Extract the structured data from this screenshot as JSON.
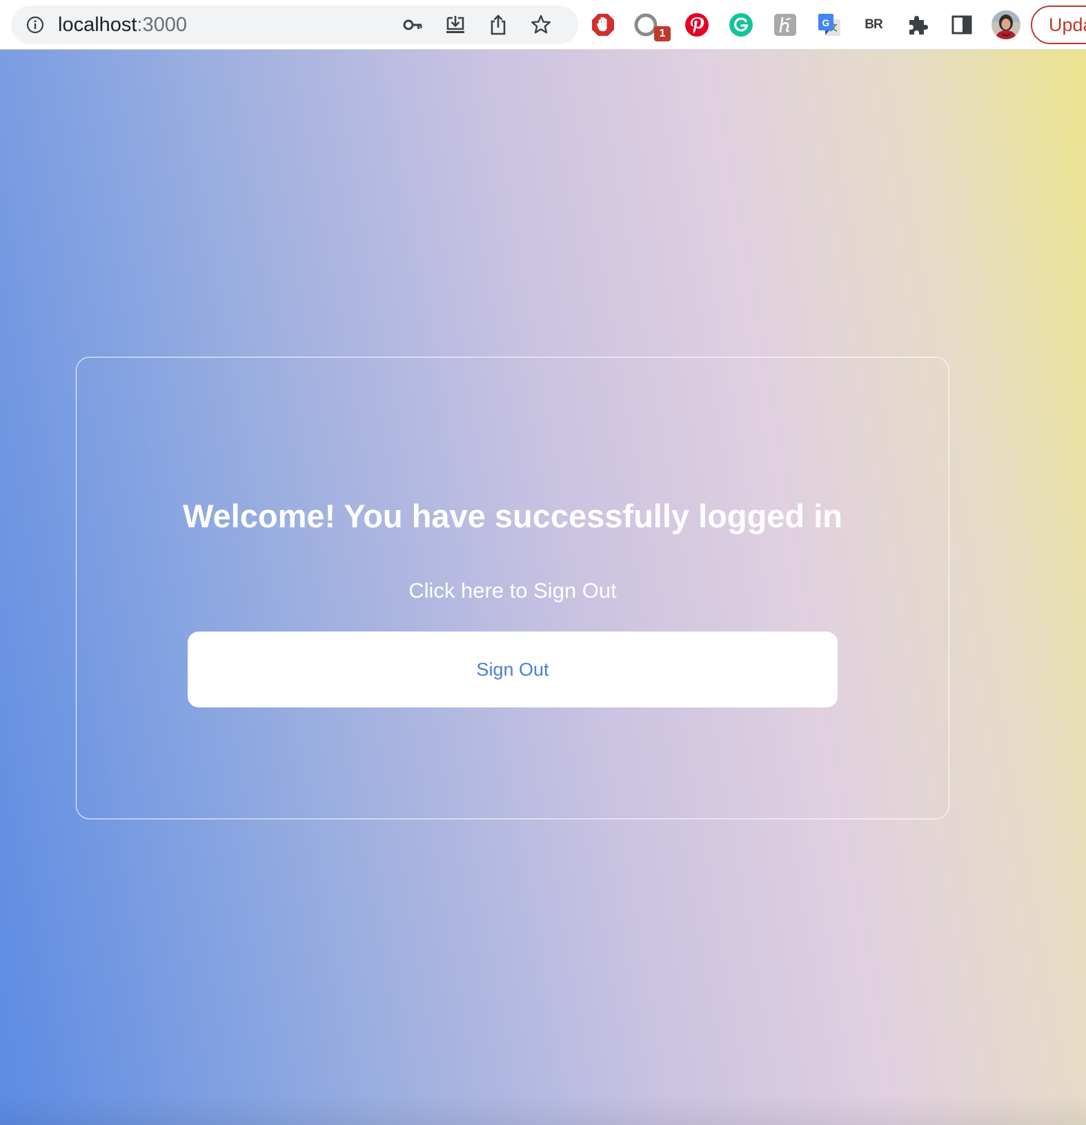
{
  "browser": {
    "url_host": "localhost",
    "url_port": ":3000",
    "extension_badge_count": "1",
    "br_extension_label": "BR",
    "update_button_label": "Upda",
    "colors": {
      "omnibox_bg": "#f1f3f4",
      "update_red": "#c0392b",
      "pinterest_red": "#e60023",
      "grammarly_green": "#15c39a",
      "adblock_red": "#d32f2f"
    },
    "icons": [
      "info-icon",
      "key-icon",
      "install-app-icon",
      "share-icon",
      "bookmark-star-icon",
      "adblock-icon",
      "circle-extension-icon",
      "pinterest-icon",
      "grammarly-icon",
      "h-extension-icon",
      "google-translate-icon",
      "br-extension-icon",
      "extensions-puzzle-icon",
      "side-panel-icon",
      "profile-avatar"
    ]
  },
  "page": {
    "headline": "Welcome! You have successfully logged in",
    "prompt": "Click here to Sign Out",
    "sign_out_button_label": "Sign Out",
    "colors": {
      "gradient_start": "#5b8be3",
      "gradient_mid": "#e0d0e0",
      "gradient_end": "#ece38e",
      "button_text": "#4a7fd6"
    }
  }
}
